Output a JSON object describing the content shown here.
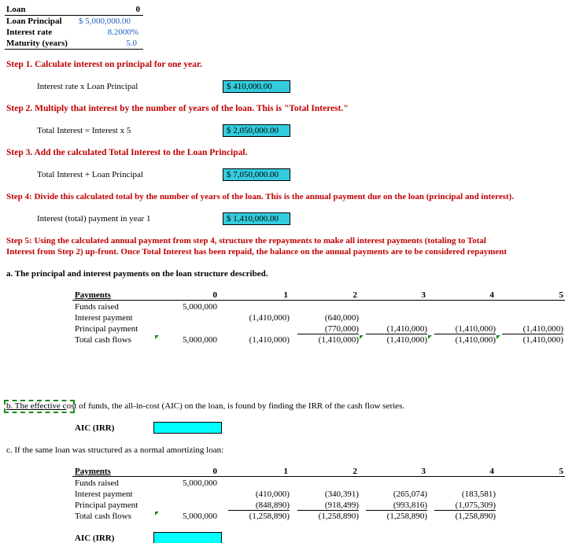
{
  "loan": {
    "title": "Loan",
    "title_value": "0",
    "principal_label": "Loan Principal",
    "principal_value": "$ 5,000,000.00",
    "rate_label": "Interest rate",
    "rate_value": "8.2000%",
    "maturity_label": "Maturity (years)",
    "maturity_value": "5.0"
  },
  "steps": [
    {
      "heading": "Step 1. Calculate interest on principal for one year.",
      "label": "Interest rate x Loan Principal",
      "value": "$ 410,000.00"
    },
    {
      "heading": "Step 2. Multiply that interest by the number of years of the loan. This is \"Total Interest.\"",
      "label": "Total Interest = Interest x 5",
      "value": "$ 2,050,000.00"
    },
    {
      "heading": "Step 3. Add the calculated Total Interest to the Loan Principal.",
      "label": "Total Interest + Loan Principal",
      "value": "$ 7,050,000.00"
    },
    {
      "heading": "Step 4: Divide this calculated total by the number of years of the loan. This is the annual payment due on the loan (principal and interest).",
      "label": "Interest (total) payment in year 1",
      "value": "$ 1,410,000.00"
    }
  ],
  "step5": {
    "line1": "Step 5: Using the calculated annual payment from step 4, structure the repayments to make all interest payments (totaling to Total",
    "line2": "Interest from Step 2) up-front. Once Total Interest has been repaid, the balance on the annual payments are to be considered repayment"
  },
  "part_a": {
    "heading": "a. The principal and interest payments on the loan structure described.",
    "table": {
      "header": [
        "Payments",
        "0",
        "1",
        "2",
        "3",
        "4",
        "5"
      ],
      "rows": [
        {
          "label": "Funds raised",
          "cells": [
            "5,000,000",
            "",
            "",
            "",
            "",
            ""
          ]
        },
        {
          "label": "Interest payment",
          "cells": [
            "",
            "(1,410,000)",
            "(640,000)",
            "",
            "",
            ""
          ]
        },
        {
          "label": "Principal payment",
          "cells": [
            "",
            "",
            "(770,000)",
            "(1,410,000)",
            "(1,410,000)",
            "(1,410,000)"
          ]
        },
        {
          "label": "Total cash flows",
          "cells": [
            "5,000,000",
            "(1,410,000)",
            "(1,410,000)",
            "(1,410,000)",
            "(1,410,000)",
            "(1,410,000)"
          ]
        }
      ]
    }
  },
  "part_b": {
    "selected_text": "b. The effective c",
    "rest_text": "ost of funds, the all-in-cost (AIC) on the loan, is found by finding the IRR of the cash flow series.",
    "aic_label": "AIC (IRR)"
  },
  "part_c": {
    "heading": "c. If the same loan was structured as a normal amortizing loan:",
    "table": {
      "header": [
        "Payments",
        "0",
        "1",
        "2",
        "3",
        "4",
        "5"
      ],
      "rows": [
        {
          "label": "Funds raised",
          "cells": [
            "5,000,000",
            "",
            "",
            "",
            "",
            ""
          ]
        },
        {
          "label": "Interest payment",
          "cells": [
            "",
            "(410,000)",
            "(340,391)",
            "(265,074)",
            "(183,581)",
            ""
          ]
        },
        {
          "label": "Principal payment",
          "cells": [
            "",
            "(848,890)",
            "(918,499)",
            "(993,816)",
            "(1,075,309)",
            ""
          ]
        },
        {
          "label": "Total cash flows",
          "cells": [
            "5,000,000",
            "(1,258,890)",
            "(1,258,890)",
            "(1,258,890)",
            "(1,258,890)",
            ""
          ]
        }
      ]
    },
    "aic_label": "AIC (IRR)"
  }
}
